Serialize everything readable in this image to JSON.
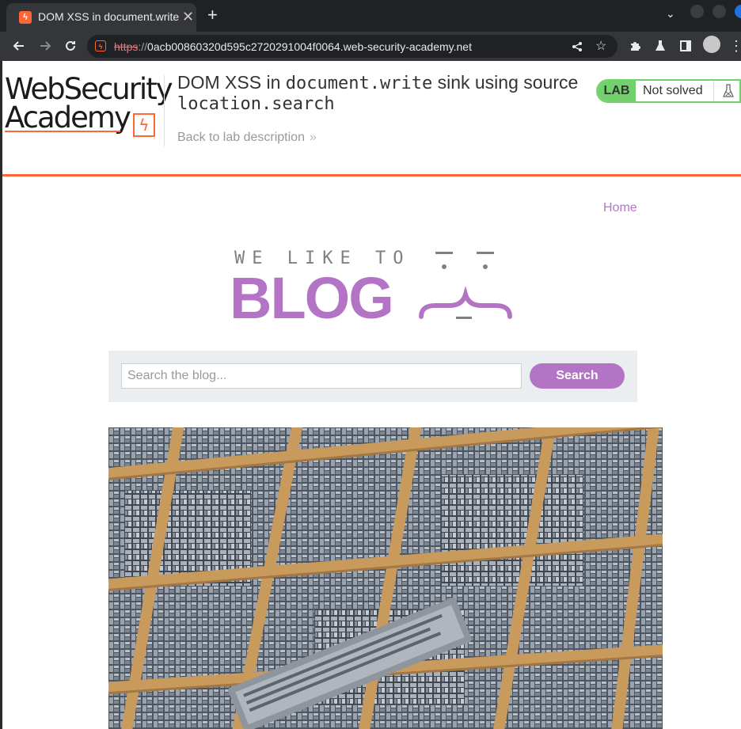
{
  "browser": {
    "tab_title": "DOM XSS in document.write sink using source location.search",
    "tab_close": "✕",
    "new_tab": "+",
    "url_scheme": "https",
    "url_sep": "://",
    "url_host": "0acb00860320d595c2720291004f0064.web-security-academy.net",
    "accent": "#ff6633"
  },
  "lab": {
    "logo_line1": "WebSecurity",
    "logo_line2": "Academy",
    "title_prefix": "DOM XSS in ",
    "title_code1": "document.write",
    "title_middle": " sink using source ",
    "title_code2": "location.search",
    "back_link": "Back to lab description",
    "status_badge": "LAB",
    "status_text": "Not solved",
    "status_color": "#70d16d"
  },
  "blog": {
    "nav_home": "Home",
    "brand_top": "WE LIKE TO",
    "brand_main": "BLOG",
    "brand_color": "#b474c5",
    "search_placeholder": "Search the blog...",
    "search_button": "Search"
  },
  "icons": {
    "back": "arrow-left-icon",
    "forward": "arrow-right-icon",
    "reload": "reload-icon",
    "share": "share-icon",
    "bookmark": "star-icon",
    "extensions": "puzzle-icon",
    "labs": "flask-icon",
    "sidepanel": "sidepanel-icon",
    "profile": "avatar-icon",
    "menu": "kebab-menu-icon"
  }
}
